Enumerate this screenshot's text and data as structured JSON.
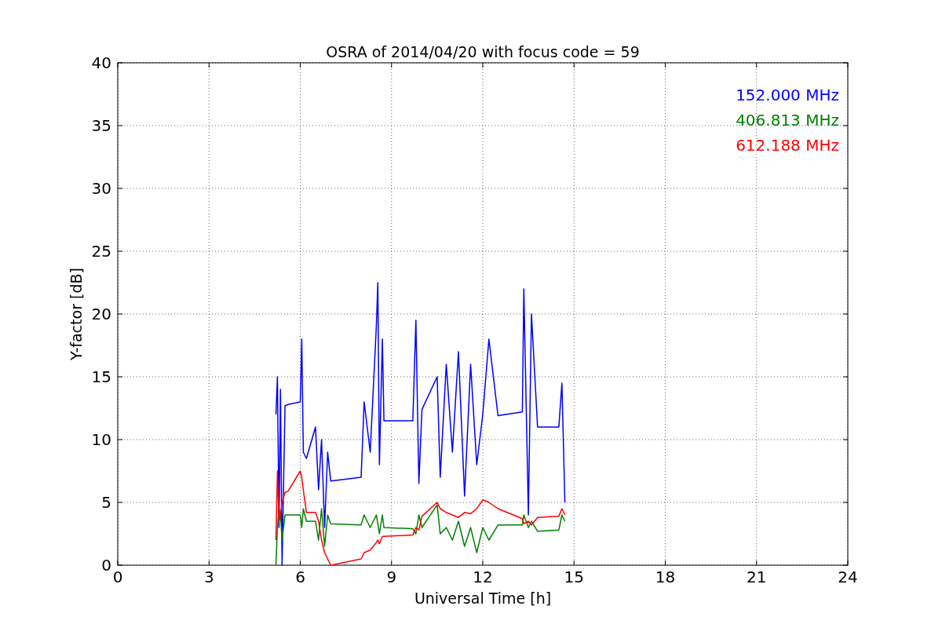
{
  "chart": {
    "chart_data": {
      "type": "line",
      "grid": true,
      "title": "OSRA of 2014/04/20 with focus code = 59",
      "xlabel": "Universal Time [h]",
      "ylabel": "Y-factor [dB]",
      "xlim": [
        0,
        24
      ],
      "ylim": [
        0,
        40
      ],
      "xticks": [
        0,
        3,
        6,
        9,
        12,
        15,
        18,
        21,
        24
      ],
      "yticks": [
        0,
        5,
        10,
        15,
        20,
        25,
        30,
        35,
        40
      ],
      "x": [
        5.2,
        5.25,
        5.3,
        5.35,
        5.4,
        5.5,
        5.6,
        6.0,
        6.05,
        6.1,
        6.2,
        6.5,
        6.6,
        6.7,
        6.8,
        6.9,
        7.0,
        8.0,
        8.1,
        8.3,
        8.5,
        8.55,
        8.6,
        8.7,
        8.75,
        9.7,
        9.8,
        9.9,
        10.0,
        10.5,
        10.6,
        10.8,
        11.0,
        11.2,
        11.4,
        11.6,
        11.8,
        12.0,
        12.2,
        12.5,
        13.3,
        13.35,
        13.5,
        13.6,
        13.8,
        14.5,
        14.6,
        14.7
      ],
      "series": [
        {
          "name": "152.000 MHz",
          "color": "#0000ff",
          "values": [
            12,
            15,
            3,
            14,
            0,
            12.7,
            12.8,
            13,
            18,
            9,
            8.5,
            11,
            6,
            10,
            3,
            9,
            6.7,
            7,
            13,
            9,
            19,
            22.5,
            8,
            18,
            11.5,
            11.5,
            19.5,
            6.5,
            12.4,
            15,
            7,
            16,
            9,
            17,
            5.5,
            16,
            8,
            12,
            18,
            11.9,
            12.2,
            22,
            4,
            20,
            11,
            11,
            14.5,
            5
          ]
        },
        {
          "name": "406.813 MHz",
          "color": "#008000",
          "values": [
            0,
            3,
            4.5,
            4,
            2,
            4,
            4,
            4,
            3,
            4.5,
            3.5,
            3.5,
            2,
            4.5,
            1.5,
            4,
            3.3,
            3.2,
            4,
            3,
            4,
            3.3,
            2.5,
            4,
            3,
            2.9,
            2.5,
            4,
            3,
            4.8,
            2.5,
            3,
            2,
            3.5,
            1.5,
            3,
            1,
            3,
            2,
            3.2,
            3.2,
            4,
            3,
            3.5,
            2.7,
            2.8,
            4,
            3.5
          ]
        },
        {
          "name": "612.188 MHz",
          "color": "#ff0000",
          "values": [
            2,
            7.5,
            3.5,
            4,
            5,
            5.8,
            5.9,
            7.5,
            7,
            6,
            4.2,
            4.2,
            3.5,
            2,
            1,
            0.5,
            0,
            0.5,
            1,
            1.2,
            1.8,
            2,
            1.7,
            2.3,
            2.3,
            2.4,
            3,
            2.8,
            3.9,
            5,
            4.5,
            4.2,
            4,
            3.8,
            4.2,
            4.1,
            4.5,
            5.2,
            5,
            4.5,
            3.7,
            3.3,
            3.5,
            3.2,
            3.8,
            3.9,
            4.5,
            4
          ]
        }
      ]
    }
  }
}
